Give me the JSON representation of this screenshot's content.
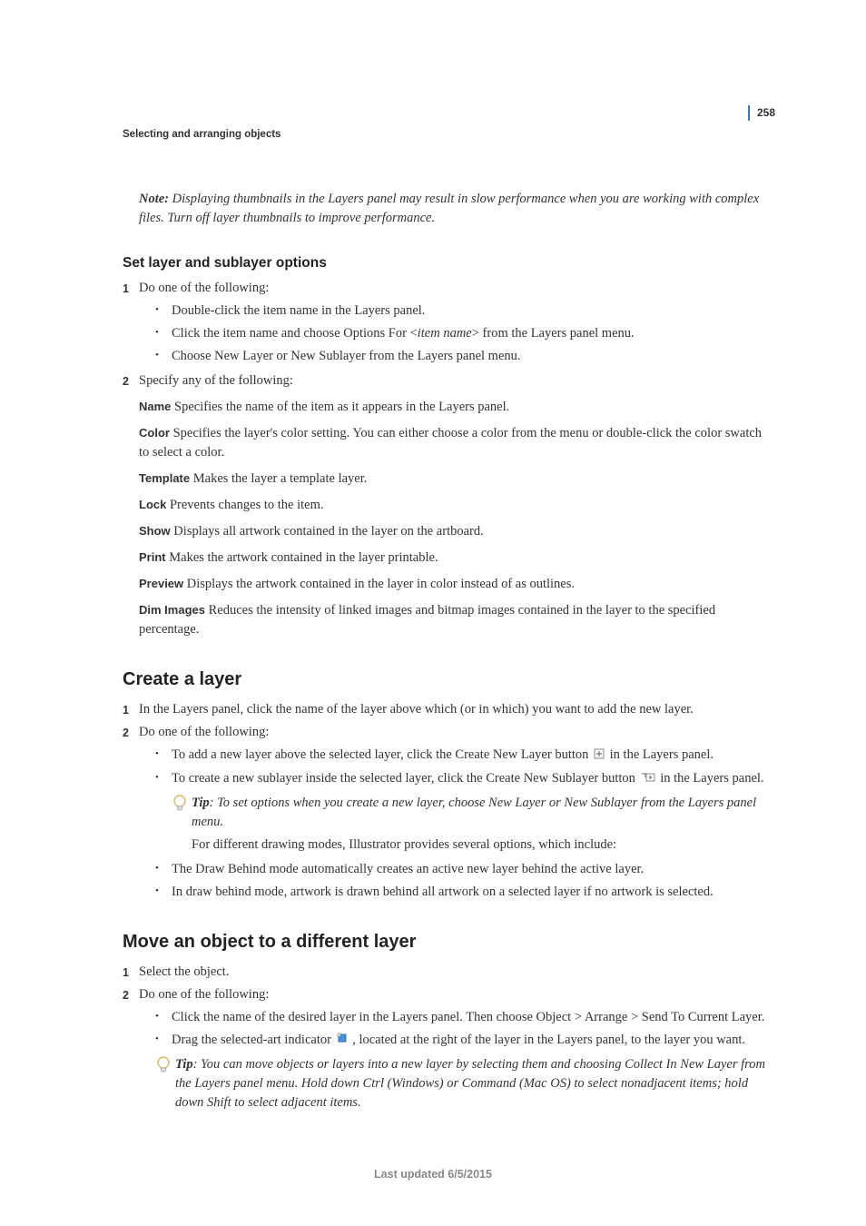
{
  "page_number": "258",
  "running_head": "Selecting and arranging objects",
  "note": {
    "label": "Note:",
    "text": " Displaying thumbnails in the Layers panel may result in slow performance when you are working with complex files. Turn off layer thumbnails to improve performance."
  },
  "section1": {
    "heading": "Set layer and sublayer options",
    "step1_num": "1",
    "step1_text": "Do one of the following:",
    "b1": "Double-click the item name in the Layers panel.",
    "b2a": "Click the item name and choose Options For <",
    "b2b": "item name",
    "b2c": "> from the Layers panel menu.",
    "b3": "Choose New Layer or New Sublayer from the Layers panel menu.",
    "step2_num": "2",
    "step2_text": "Specify any of the following:",
    "defs": {
      "name": {
        "term": "Name",
        "body": " Specifies the name of the item as it appears in the Layers panel."
      },
      "color": {
        "term": "Color",
        "body": " Specifies the layer's color setting. You can either choose a color from the menu or double-click the color swatch to select a color."
      },
      "template": {
        "term": "Template",
        "body": " Makes the layer a template layer."
      },
      "lock": {
        "term": "Lock",
        "body": " Prevents changes to the item."
      },
      "show": {
        "term": "Show",
        "body": " Displays all artwork contained in the layer on the artboard."
      },
      "print": {
        "term": "Print",
        "body": " Makes the artwork contained in the layer printable."
      },
      "preview": {
        "term": "Preview",
        "body": " Displays the artwork contained in the layer in color instead of as outlines."
      },
      "dim": {
        "term": "Dim Images",
        "body": " Reduces the intensity of linked images and bitmap images contained in the layer to the specified percentage."
      }
    }
  },
  "section2": {
    "heading": "Create a layer",
    "step1_num": "1",
    "step1_text": "In the Layers panel, click the name of the layer above which (or in which) you want to add the new layer.",
    "step2_num": "2",
    "step2_text": "Do one of the following:",
    "b1a": "To add a new layer above the selected layer, click the Create New Layer button ",
    "b1b": " in the Layers panel.",
    "b2a": "To create a new sublayer inside the selected layer, click the Create New Sublayer button ",
    "b2b": " in the Layers panel.",
    "tip_label": "Tip",
    "tip_text": ": To set options when you create a new layer, choose New Layer or New Sublayer from the Layers panel menu.",
    "tip_follow": "For different drawing modes, Illustrator provides several options, which include:",
    "b3": "The Draw Behind mode automatically creates an active new layer behind the active layer.",
    "b4": "In draw behind mode, artwork is drawn behind all artwork on a selected layer if no artwork is selected."
  },
  "section3": {
    "heading": "Move an object to a different layer",
    "step1_num": "1",
    "step1_text": "Select the object.",
    "step2_num": "2",
    "step2_text": "Do one of the following:",
    "b1": "Click the name of the desired layer in the Layers panel. Then choose Object > Arrange > Send To Current Layer.",
    "b2a": "Drag the selected-art indicator ",
    "b2b": " , located at the right of the layer in the Layers panel, to the layer you want.",
    "tip_label": "Tip",
    "tip_text": ": You can move objects or layers into a new layer by selecting them and choosing Collect In New Layer from the Layers panel menu. Hold down Ctrl (Windows) or Command (Mac OS) to select nonadjacent items; hold down Shift to select adjacent items."
  },
  "footer": "Last updated 6/5/2015"
}
